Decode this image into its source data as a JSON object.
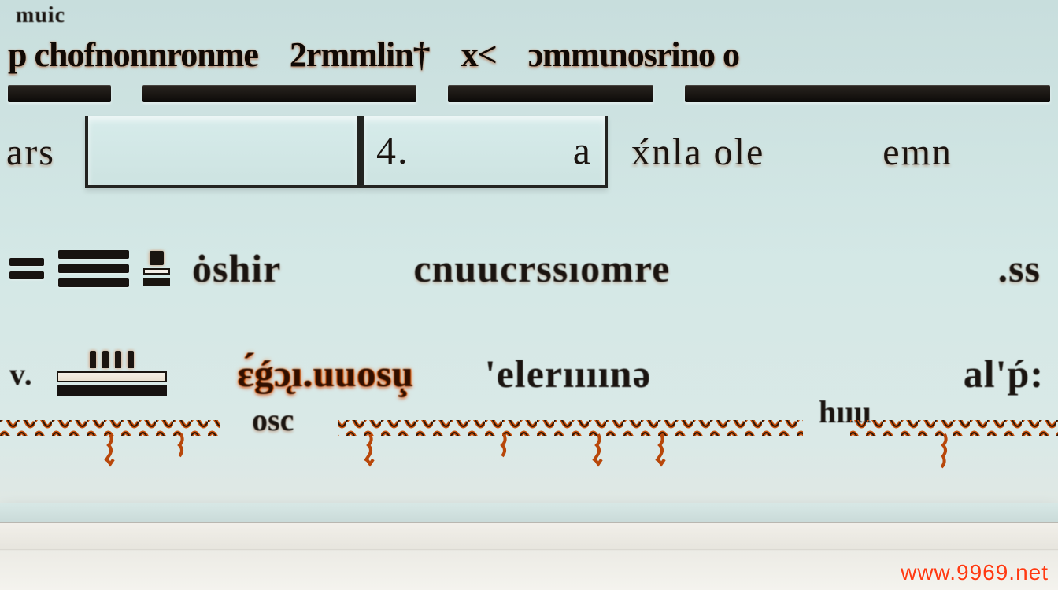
{
  "top_fragments": [
    "",
    "muic",
    ""
  ],
  "labels_row": {
    "a": "p chofnonnronme",
    "b": "2rmmlin†",
    "c": "x<",
    "d": "ɔmmɩnosrino o"
  },
  "cells": {
    "left": "ars",
    "box_b_left": "4.",
    "box_b_right": "a",
    "right_a": "x́nla ole",
    "right_b": "emn"
  },
  "icons_row": {
    "text1": "ȯshir",
    "text2": "cnuucrssıomre",
    "text3": ".ss"
  },
  "orange_row": {
    "v": "v.",
    "seg1": "ɛ́ǵɔ̨ı.uuosu̧",
    "seg2": "'elerıııınǝ",
    "seg3": "al'ṕ:"
  },
  "small_text": "osc",
  "hill_text": "hıııı",
  "watermark": "www.9969.net",
  "colors": {
    "bg": "#d4e8e6",
    "ink": "#1a1410",
    "accent": "#d45a0a",
    "watermark": "#ff3a12"
  }
}
